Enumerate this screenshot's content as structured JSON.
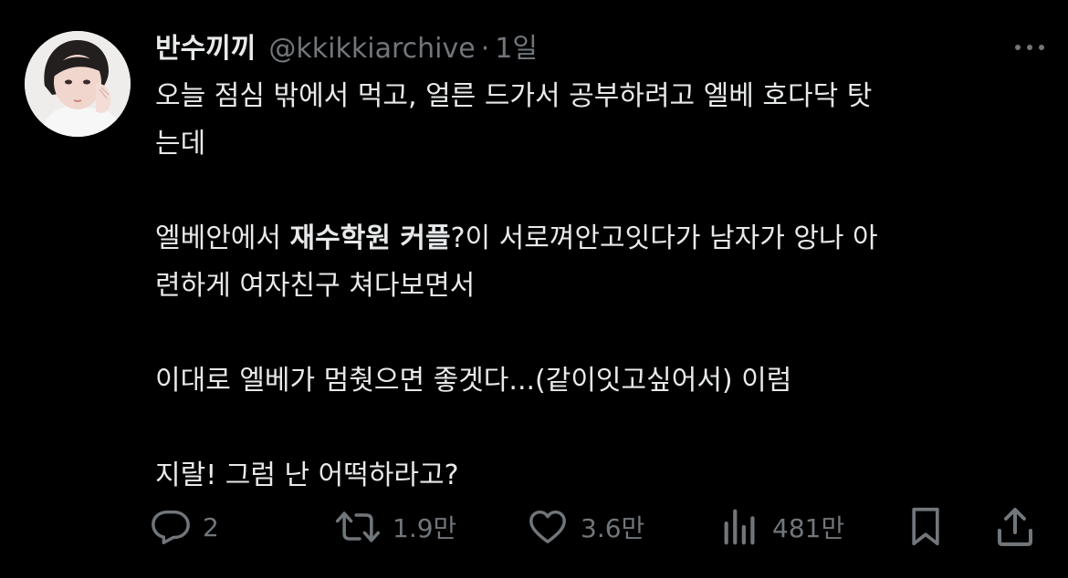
{
  "tweet": {
    "display_name": "반수끼끼",
    "handle": "@kkikkiarchive",
    "separator": "·",
    "time": "1일",
    "lines": [
      "오늘 점심 밖에서 먹고, 얼른 드가서 공부하려고 엘베 호다닥 탓",
      "는데",
      "",
      "엘베안에서 ",
      "재수학원 커플",
      "?이 서로껴안고잇다가 남자가 앙나 아",
      "련하게 여자친구 쳐다보면서",
      "",
      "이대로 엘베가 멈췃으면 좋겟다...(같이잇고싶어서) 이럼",
      "",
      "지랄! 그럼 난 어떡하라고?"
    ]
  },
  "actions": {
    "reply": {
      "icon": "reply-icon",
      "count": "2"
    },
    "retweet": {
      "icon": "retweet-icon",
      "count": "1.9만"
    },
    "like": {
      "icon": "heart-icon",
      "count": "3.6만"
    },
    "views": {
      "icon": "views-icon",
      "count": "481만"
    },
    "bookmark": {
      "icon": "bookmark-icon"
    },
    "share": {
      "icon": "share-icon"
    }
  },
  "colors": {
    "background": "#000000",
    "text": "#e7e9ea",
    "secondary": "#71767b"
  }
}
